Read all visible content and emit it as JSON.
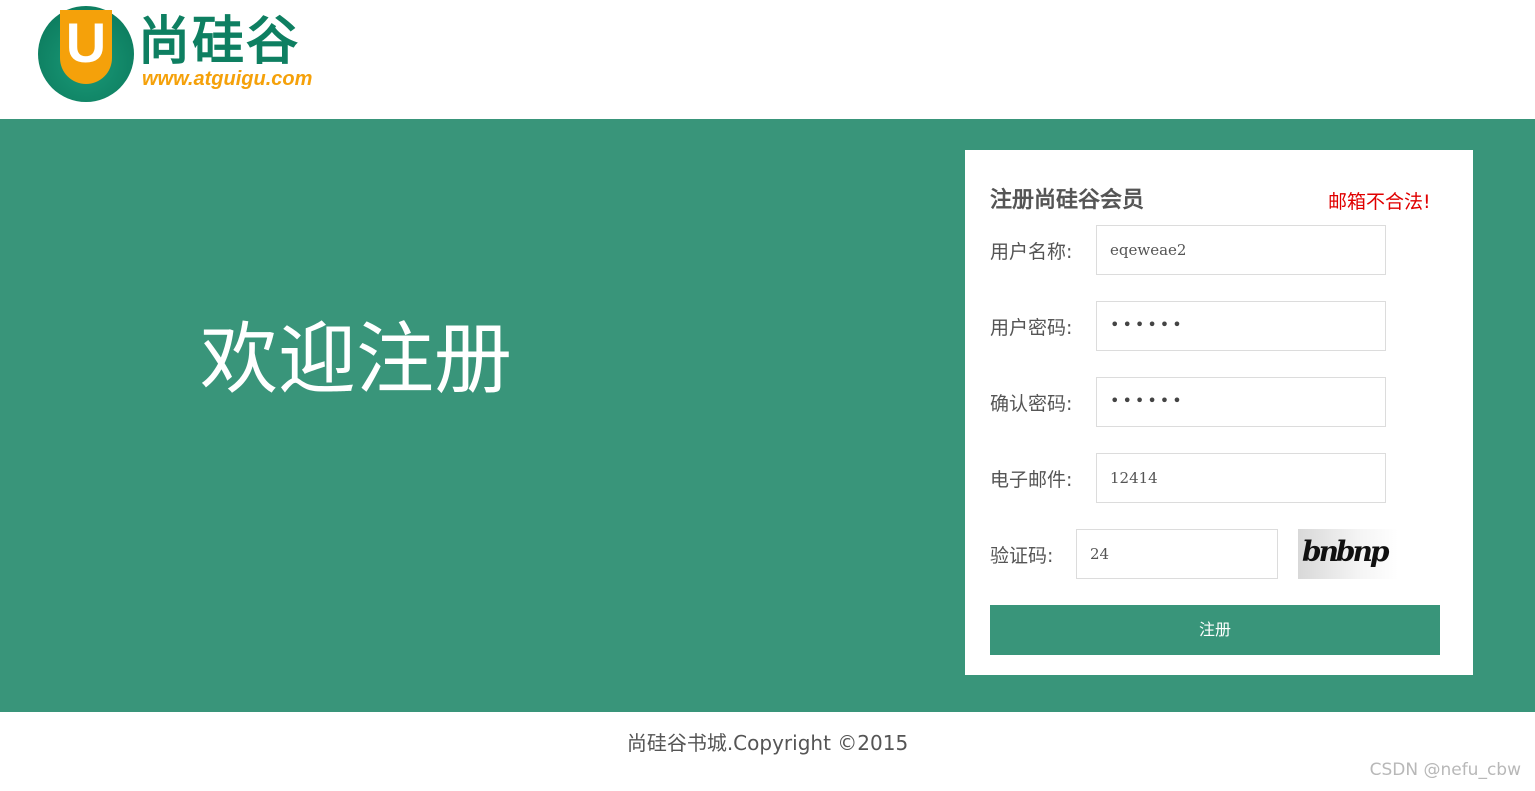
{
  "header": {
    "logo_letter": "U",
    "logo_name": "尚硅谷",
    "logo_url": "www.atguigu.com"
  },
  "banner": {
    "welcome_text": "欢迎注册"
  },
  "form": {
    "title": "注册尚硅谷会员",
    "error_message": "邮箱不合法!",
    "username": {
      "label": "用户名称:",
      "value": "eqeweae2"
    },
    "password": {
      "label": "用户密码:",
      "value": "••••••"
    },
    "repassword": {
      "label": "确认密码:",
      "value": "••••••"
    },
    "email": {
      "label": "电子邮件:",
      "value": "12414"
    },
    "code": {
      "label": "验证码:",
      "value": "24",
      "captcha_text": "bnbnp"
    },
    "submit_label": "注册"
  },
  "footer": {
    "copyright": "尚硅谷书城.Copyright ©2015"
  },
  "watermark": "CSDN @nefu_cbw",
  "colors": {
    "primary": "#39957a",
    "logo_green": "#0e7f61",
    "logo_orange": "#f5a10a",
    "error": "#e00000"
  }
}
